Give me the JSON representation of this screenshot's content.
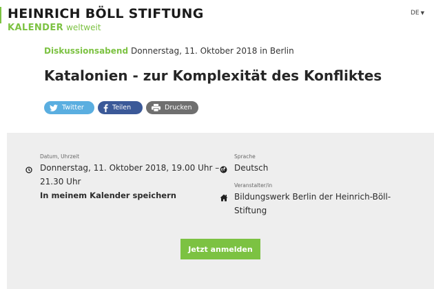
{
  "header": {
    "brand_name": "HEINRICH BÖLL STIFTUNG",
    "brand_sub_bold": "KALENDER",
    "brand_sub_light": "weltweit",
    "language": "DE",
    "accent_color": "#7cc242"
  },
  "event": {
    "type": "Diskussionsabend",
    "date_location": "Donnerstag, 11. Oktober 2018 in Berlin",
    "title": "Katalonien - zur Komplexität des Konfliktes"
  },
  "share": {
    "twitter": "Twitter",
    "facebook": "Teilen",
    "print": "Drucken"
  },
  "details": {
    "datetime_label": "Datum, Uhrzeit",
    "datetime_line1": "Donnerstag, 11. Oktober 2018, 19.00 Uhr –",
    "datetime_line2": "21.30 Uhr",
    "save_calendar": "In meinem Kalender speichern",
    "language_label": "Sprache",
    "language_value": "Deutsch",
    "organizer_label": "Veranstalter/in",
    "organizer_line1": "Bildungswerk Berlin der Heinrich-Böll-",
    "organizer_line2": "Stiftung",
    "register_button": "Jetzt anmelden"
  },
  "icons": {
    "clock": "clock-icon",
    "globe": "globe-icon",
    "home": "home-icon",
    "twitter": "twitter-icon",
    "facebook": "facebook-icon",
    "print": "printer-icon"
  }
}
